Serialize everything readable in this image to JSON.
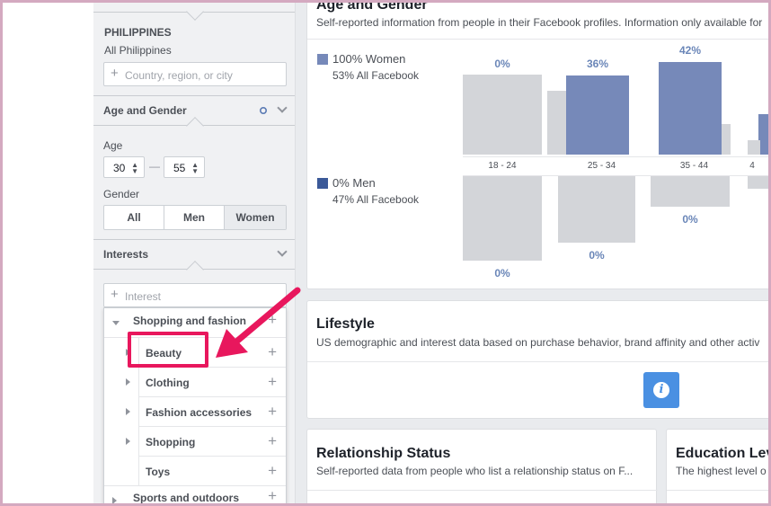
{
  "location": {
    "country": "PHILIPPINES",
    "scope": "All Philippines",
    "placeholder": "Country, region, or city"
  },
  "age_gender": {
    "section_title": "Age and Gender",
    "age_label": "Age",
    "age_min": "30",
    "age_max": "55",
    "dash": "—",
    "gender_label": "Gender",
    "gender_options": [
      "All",
      "Men",
      "Women"
    ],
    "gender_selected": "Women"
  },
  "interests": {
    "section_title": "Interests",
    "placeholder": "Interest",
    "items": [
      {
        "label": "Shopping and fashion",
        "expanded": true
      },
      {
        "label": "Beauty"
      },
      {
        "label": "Clothing"
      },
      {
        "label": "Fashion accessories"
      },
      {
        "label": "Shopping"
      },
      {
        "label": "Toys"
      },
      {
        "label": "Sports and outdoors"
      }
    ]
  },
  "main": {
    "age_gender_card": {
      "title": "Age and Gender",
      "subtitle": "Self-reported information from people in their Facebook profiles. Information only available for",
      "women": {
        "label": "100% Women",
        "sub": "53% All Facebook",
        "color": "#7689b9"
      },
      "men": {
        "label": "0% Men",
        "sub": "47% All Facebook",
        "color": "#3b5998"
      },
      "age_groups": [
        "18 - 24",
        "25 - 34",
        "35 - 44",
        "4"
      ],
      "women_pcts": [
        "0%",
        "36%",
        "42%"
      ],
      "men_pcts": [
        "0%",
        "0%",
        "0%"
      ]
    },
    "lifestyle": {
      "title": "Lifestyle",
      "subtitle": "US demographic and interest data based on purchase behavior, brand affinity and other activ"
    },
    "relationship": {
      "title": "Relationship Status",
      "subtitle": "Self-reported data from people who list a relationship status on F..."
    },
    "education": {
      "title": "Education Lev",
      "subtitle": "The highest level o"
    }
  },
  "chart_data": {
    "type": "bar",
    "title": "",
    "categories": [
      "18 - 24",
      "25 - 34",
      "35 - 44"
    ],
    "series": [
      {
        "name": "100% Women",
        "values": [
          0,
          36,
          42
        ]
      },
      {
        "name": "0% Men",
        "values": [
          0,
          0,
          0
        ]
      }
    ],
    "ylim": [
      0,
      45
    ]
  },
  "colors": {
    "accent": "#4a90e2",
    "highlight": "#e8175d",
    "women_bar": "#7689b9",
    "baseline_bar": "#d3d5d9"
  },
  "icons": {
    "gear": "gear-icon",
    "info": "info-icon"
  }
}
